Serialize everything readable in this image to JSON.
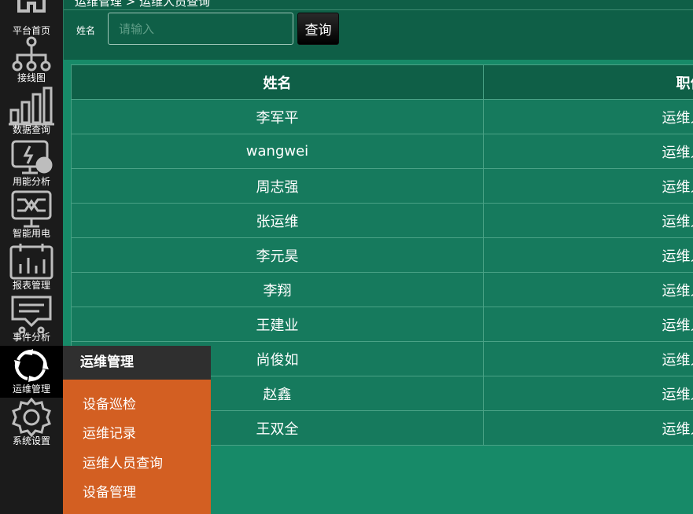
{
  "nav": {
    "items": [
      {
        "label": "平台首页",
        "icon": "home-icon"
      },
      {
        "label": "接线图",
        "icon": "wiring-diagram-icon"
      },
      {
        "label": "数据查询",
        "icon": "bar-chart-icon"
      },
      {
        "label": "用能分析",
        "icon": "energy-analysis-icon"
      },
      {
        "label": "智能用电",
        "icon": "smart-power-icon"
      },
      {
        "label": "报表管理",
        "icon": "report-icon"
      },
      {
        "label": "事件分析",
        "icon": "event-icon"
      },
      {
        "label": "运维管理",
        "icon": "refresh-icon"
      },
      {
        "label": "系统设置",
        "icon": "gear-icon"
      }
    ]
  },
  "header": {
    "breadcrumb": "运维管理 > 运维人员查询",
    "filter_label": "姓名",
    "search_placeholder": "请输入",
    "search_value": "",
    "query_button": "查询"
  },
  "table": {
    "columns": [
      "姓名",
      "职位"
    ],
    "rows": [
      [
        "李军平",
        "运维人员"
      ],
      [
        "wangwei",
        "运维人员"
      ],
      [
        "周志强",
        "运维人员"
      ],
      [
        "张运维",
        "运维人员"
      ],
      [
        "李元昊",
        "运维人员"
      ],
      [
        "李翔",
        "运维人员"
      ],
      [
        "王建业",
        "运维人员"
      ],
      [
        "尚俊如",
        "运维人员"
      ],
      [
        "赵鑫",
        "运维人员"
      ],
      [
        "王双全",
        "运维人员"
      ]
    ]
  },
  "submenu": {
    "title": "运维管理",
    "items": [
      "设备巡检",
      "运维记录",
      "运维人员查询",
      "设备管理"
    ]
  },
  "colors": {
    "sidebar": "#1b1b1b",
    "main_bg": "#178a68",
    "header_bg": "#0f5f47",
    "submenu_bg": "#d35f22"
  }
}
